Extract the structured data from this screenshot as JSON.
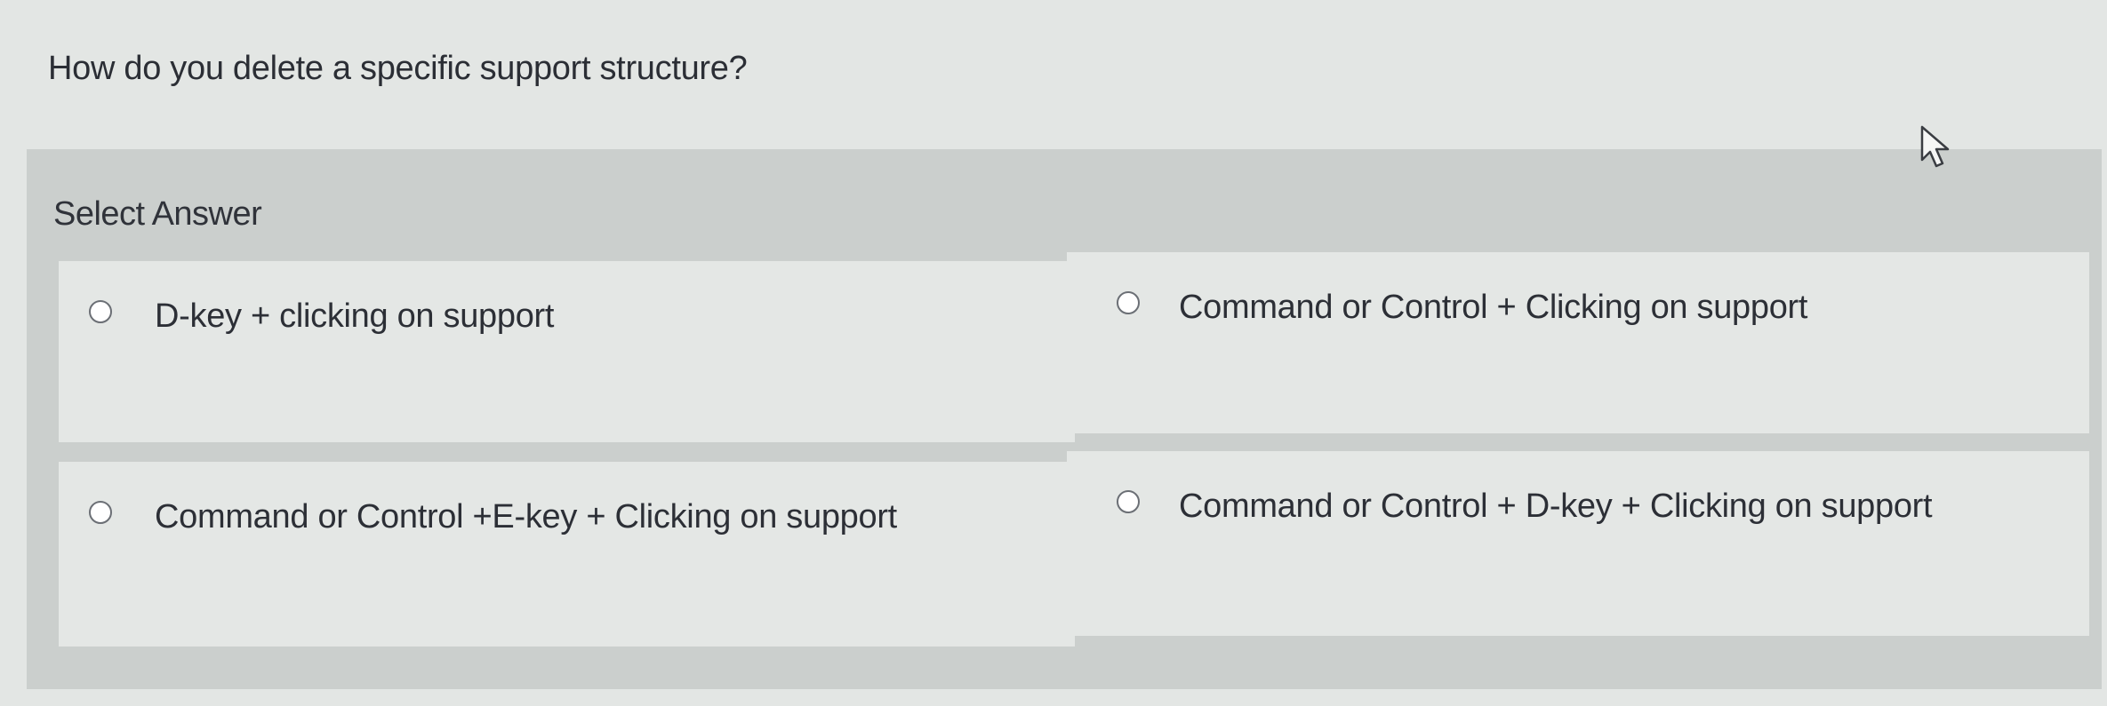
{
  "question": {
    "text": "How do you delete a specific support structure?"
  },
  "answer_panel": {
    "heading": "Select Answer",
    "options": [
      {
        "label": "D-key + clicking on support",
        "selected": false
      },
      {
        "label": "Command or Control + Clicking on support",
        "selected": false
      },
      {
        "label": "Command or Control +E-key + Clicking on support",
        "selected": false
      },
      {
        "label": "Command or Control + D-key + Clicking on support",
        "selected": false
      }
    ]
  },
  "cursor": {
    "icon": "mouse-pointer-icon"
  },
  "colors": {
    "page_background": "#e3e6e4",
    "panel_background": "#cbcfcd",
    "option_background": "#e4e7e5",
    "text": "#2c2f36"
  }
}
